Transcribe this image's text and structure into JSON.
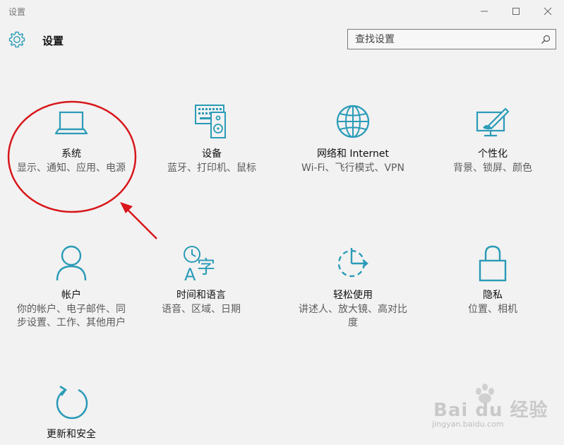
{
  "window": {
    "title": "设置"
  },
  "header": {
    "title": "设置",
    "search_placeholder": "查找设置"
  },
  "tiles": [
    {
      "label": "系统",
      "desc": "显示、通知、应用、电源",
      "icon": "laptop-icon"
    },
    {
      "label": "设备",
      "desc": "蓝牙、打印机、鼠标",
      "icon": "devices-icon"
    },
    {
      "label": "网络和 Internet",
      "desc": "Wi-Fi、飞行模式、VPN",
      "icon": "globe-icon"
    },
    {
      "label": "个性化",
      "desc": "背景、锁屏、颜色",
      "icon": "personalization-icon"
    },
    {
      "label": "帐户",
      "desc": "你的帐户、电子邮件、同步设置、工作、其他用户",
      "icon": "person-icon"
    },
    {
      "label": "时间和语言",
      "desc": "语音、区域、日期",
      "icon": "time-language-icon"
    },
    {
      "label": "轻松使用",
      "desc": "讲述人、放大镜、高对比度",
      "icon": "ease-of-access-icon"
    },
    {
      "label": "隐私",
      "desc": "位置、相机",
      "icon": "lock-icon"
    },
    {
      "label": "更新和安全",
      "desc": "",
      "icon": "update-icon"
    }
  ],
  "colors": {
    "accent": "#2a9bb7",
    "annotation": "#d8161b",
    "background": "#f2f2f2"
  },
  "watermark": {
    "brand": "Bai du 经验",
    "url": "jingyan.baidu.com"
  }
}
